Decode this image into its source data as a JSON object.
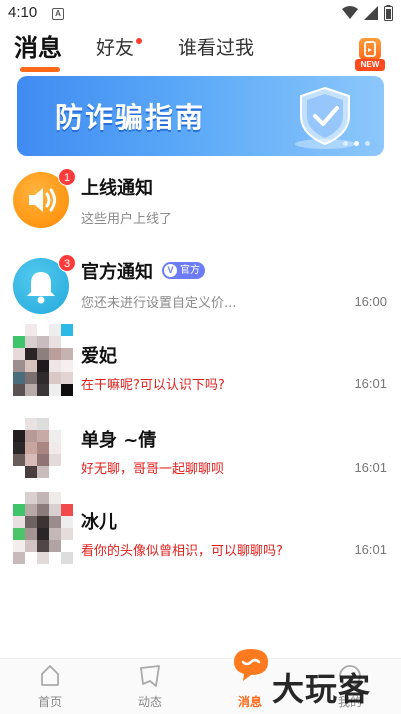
{
  "status_bar": {
    "time": "4:10",
    "notif_letter": "A"
  },
  "tabs": [
    {
      "label": "消息",
      "active": true
    },
    {
      "label": "好友",
      "active": false,
      "has_dot": true
    },
    {
      "label": "谁看过我",
      "active": false
    }
  ],
  "new_badge": "NEW",
  "banner": {
    "title": "防诈骗指南"
  },
  "messages": [
    {
      "name": "上线通知",
      "preview": "这些用户上线了",
      "time": "",
      "badge": "1",
      "preview_color": "gray"
    },
    {
      "name": "官方通知",
      "tag": "官方",
      "preview": "您还未进行设置自定义价...",
      "time": "16:00",
      "badge": "3",
      "preview_color": "gray"
    },
    {
      "name": "爱妃",
      "preview": "在干嘛呢?可以认识下吗?",
      "time": "16:01",
      "preview_color": "red"
    },
    {
      "name": "单身 ~倩",
      "preview": "好无聊，哥哥一起聊聊呗",
      "time": "16:01",
      "preview_color": "red"
    },
    {
      "name": "冰儿",
      "preview": "看你的头像似曾相识，可以聊聊吗?",
      "time": "16:01",
      "preview_color": "red"
    }
  ],
  "bottom_nav": [
    {
      "label": "首页",
      "icon": "home-icon",
      "active": false
    },
    {
      "label": "动态",
      "icon": "feed-icon",
      "active": false
    },
    {
      "label": "消息",
      "icon": "message-icon",
      "active": true
    },
    {
      "label": "我的",
      "icon": "profile-icon",
      "active": false
    }
  ],
  "watermark": "大玩客",
  "colors": {
    "accent": "#ff6a1a",
    "badge": "#ff3b3b",
    "preview_red": "#e0201c",
    "official": "#6d7cf5"
  }
}
